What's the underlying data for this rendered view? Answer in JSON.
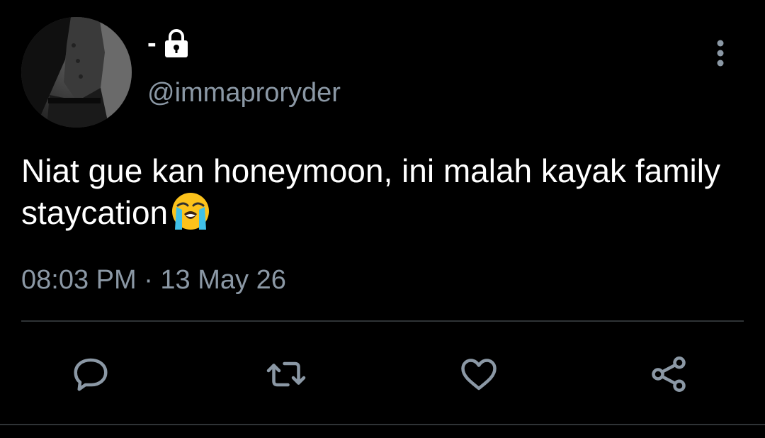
{
  "tweet": {
    "display_name": "-",
    "handle": "@immaproryder",
    "text": "Niat gue kan honeymoon, ini malah kayak family staycation",
    "emoji": "loudly-crying-face",
    "timestamp": "08:03 PM · 13 May 26"
  },
  "icons": {
    "lock": "lock-icon",
    "more": "more-vertical-icon",
    "reply": "reply-icon",
    "retweet": "retweet-icon",
    "like": "heart-icon",
    "share": "share-icon"
  },
  "colors": {
    "background": "#000000",
    "text": "#ffffff",
    "secondary": "#8b98a5",
    "divider": "#2f3336",
    "icon": "#8b98a5"
  }
}
